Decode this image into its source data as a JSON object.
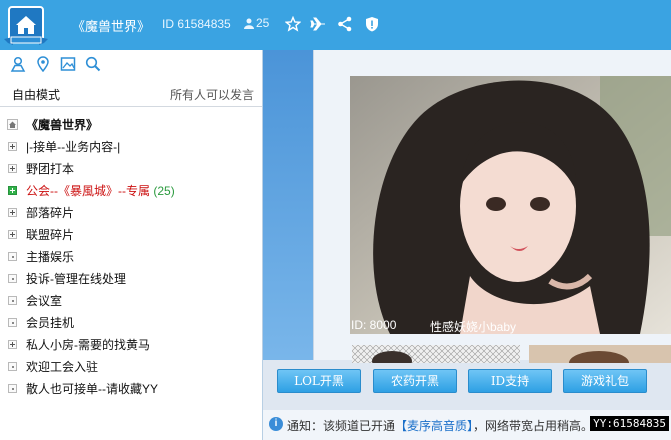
{
  "header": {
    "title": "《魔兽世界》",
    "channel_id": "ID 61584835",
    "member_count": "25",
    "icons": [
      "home-logo-icon",
      "user-icon",
      "star-icon",
      "airplane-icon",
      "share-icon",
      "shield-icon"
    ]
  },
  "left": {
    "toolbar_icons": [
      "person-icon",
      "location-icon",
      "image-icon",
      "search-icon"
    ],
    "mode_label": "自由模式",
    "permission_label": "所有人可以发言",
    "tree": [
      {
        "label": "《魔兽世界》",
        "type": "root"
      },
      {
        "label": "|-接单--业务内容-|",
        "type": "plus"
      },
      {
        "label": "野团打本",
        "type": "plus"
      },
      {
        "label": "公会--《暴風城》--专属",
        "count": "(25)",
        "type": "active"
      },
      {
        "label": "部落碎片",
        "type": "plus"
      },
      {
        "label": "联盟碎片",
        "type": "plus"
      },
      {
        "label": "主播娱乐",
        "type": "dot"
      },
      {
        "label": "投诉-管理在线处理",
        "type": "dot"
      },
      {
        "label": "会议室",
        "type": "dot"
      },
      {
        "label": "会员挂机",
        "type": "dot"
      },
      {
        "label": "私人小房-需要的找黄马",
        "type": "plus"
      },
      {
        "label": "欢迎工会入驻",
        "type": "dot"
      },
      {
        "label": "散人也可接单--请收藏YY",
        "type": "dot"
      }
    ]
  },
  "right": {
    "photo_id": "ID: 8000",
    "photo_caption": "性感妖娆小baby",
    "buttons": [
      "LOL开黑",
      "农药开黑",
      "ID支持",
      "游戏礼包"
    ],
    "notice_prefix": "通知：该频道已开通",
    "notice_highlight": "【麦序高音质】",
    "notice_suffix": "，网络带宽占用稍高。",
    "watermark": "YY:61584835"
  },
  "colors": {
    "header_bg": "#3aa3e2",
    "active_red": "#cc1111",
    "count_green": "#2a9a3e"
  }
}
